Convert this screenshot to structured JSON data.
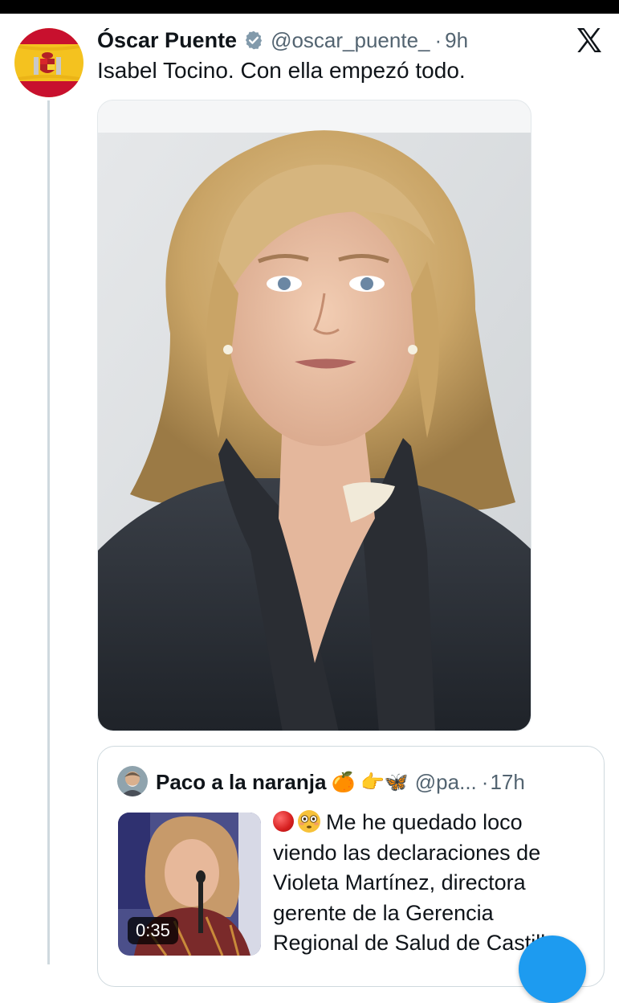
{
  "tweet": {
    "author_name": "Óscar Puente",
    "handle": "@oscar_puente_",
    "separator": "·",
    "time": "9h",
    "text": "Isabel Tocino. Con ella empezó todo."
  },
  "quote": {
    "author_name": "Paco a la naranja",
    "author_emojis": "🍊 👉🦋",
    "handle": "@pa...",
    "separator": "·",
    "time": "17h",
    "video_duration": "0:35",
    "text_lines": [
      "Me he quedado loco",
      "viendo las declaraciones de",
      "Violeta Martínez, directora",
      "gerente de la Gerencia",
      "Regional de Salud de Castill"
    ]
  },
  "icons": {
    "verified": "verified-badge-icon",
    "x_logo": "x-logo-icon",
    "red_circle": "red-circle-emoji",
    "flushed_face": "flushed-face-emoji"
  },
  "colors": {
    "text_primary": "#0f1419",
    "text_secondary": "#536471",
    "border": "#cfd9de",
    "accent": "#1d9bf0"
  }
}
